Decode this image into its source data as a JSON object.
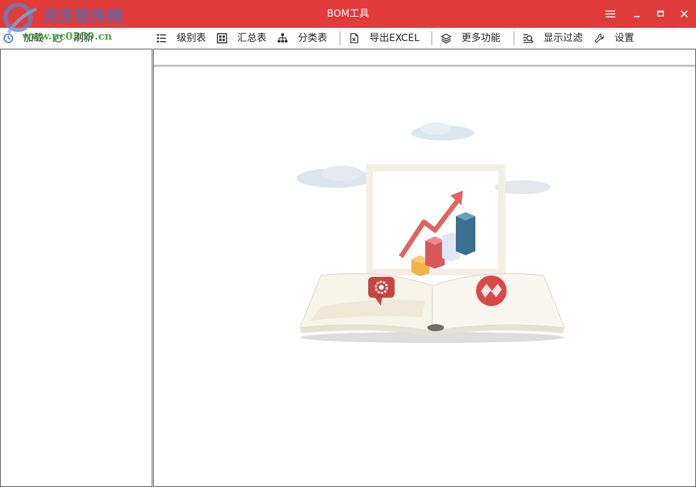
{
  "window": {
    "title": "BOM工具",
    "controls": [
      "menu-icon",
      "minimize-icon",
      "maximize-icon",
      "close-icon"
    ]
  },
  "watermark": {
    "text": "河东软件网",
    "url": "www.pc0359.cn"
  },
  "toolbar": {
    "items": [
      {
        "label": "加载",
        "icon": "load-icon"
      },
      {
        "label": "刷新",
        "icon": "refresh-icon"
      },
      {
        "label": "级别表",
        "icon": "level-list-icon"
      },
      {
        "label": "汇总表",
        "icon": "summary-grid-icon"
      },
      {
        "label": "分类表",
        "icon": "category-tree-icon"
      },
      {
        "label": "导出EXCEL",
        "icon": "excel-export-icon"
      },
      {
        "label": "更多功能",
        "icon": "layers-icon"
      },
      {
        "label": "显示过滤",
        "icon": "filter-search-icon"
      },
      {
        "label": "设置",
        "icon": "wrench-icon"
      }
    ]
  },
  "colors": {
    "titlebar": "#e03c3c",
    "border": "#555555",
    "watermark_text": "#4b6fb7",
    "watermark_url": "#38a336"
  }
}
